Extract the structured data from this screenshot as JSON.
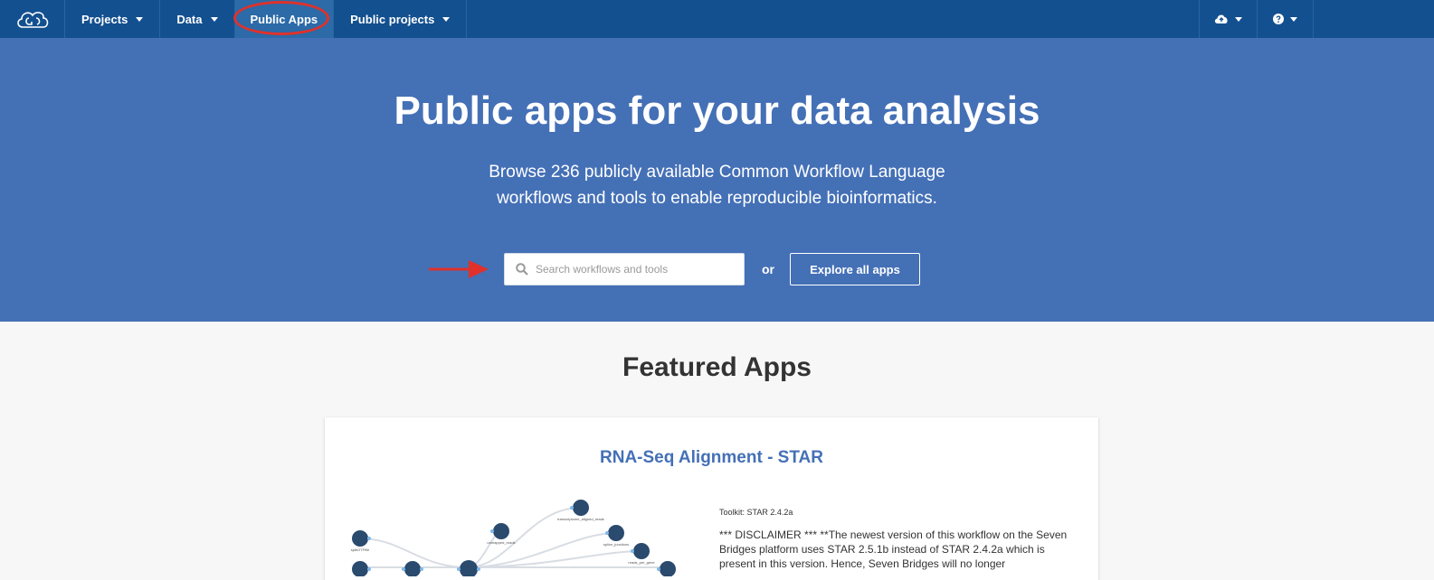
{
  "nav": {
    "items": [
      {
        "label": "Projects",
        "caret": true
      },
      {
        "label": "Data",
        "caret": true
      },
      {
        "label": "Public Apps",
        "caret": false,
        "active": true
      },
      {
        "label": "Public projects",
        "caret": true
      }
    ],
    "right": [
      {
        "icon": "cloud-upload-icon"
      },
      {
        "icon": "help-circle-icon"
      }
    ],
    "colors": {
      "bar": "#13508f",
      "active": "#2c6aa8",
      "highlight_ring": "#e0312a"
    }
  },
  "hero": {
    "title": "Public apps for your data analysis",
    "subtitle_line1": "Browse 236 publicly available Common Workflow Language",
    "subtitle_line2": "workflows and tools to enable reproducible bioinformatics.",
    "search_placeholder": "Search workflows and tools",
    "or_text": "or",
    "explore_label": "Explore all apps",
    "background": "#4470b6"
  },
  "featured": {
    "title": "Featured Apps",
    "card": {
      "title": "RNA-Seq Alignment - STAR",
      "toolkit": "Toolkit: STAR 2.4.2a",
      "description": "*** DISCLAIMER *** **The newest version of this workflow on the Seven Bridges platform uses STAR 2.5.1b instead of STAR 2.4.2a which is present in this version. Hence, Seven Bridges will no longer",
      "workflow_labels": [
        "sjdbGTFfile",
        "unmapped_reads",
        "transcriptome_aligned_reads",
        "splice_junctions",
        "reads_per_gene"
      ]
    }
  }
}
